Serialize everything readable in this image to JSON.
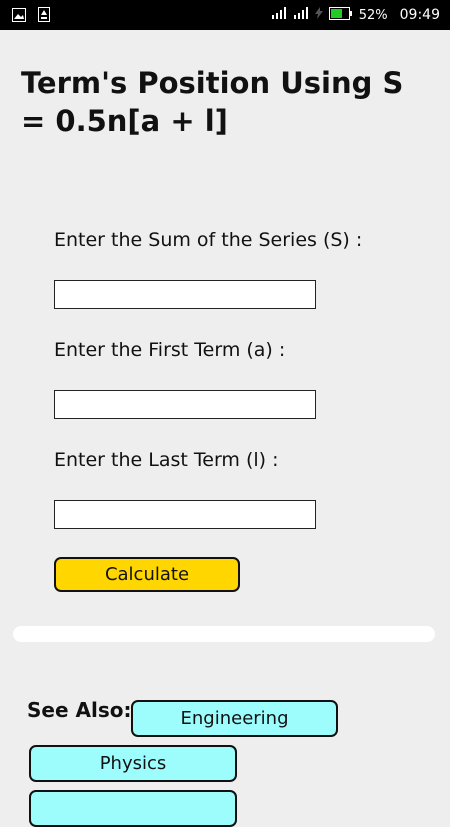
{
  "status_bar": {
    "battery_percent": "52%",
    "time": "09:49",
    "icons": [
      "gallery-icon",
      "upload-icon",
      "signal-icon",
      "signal-icon",
      "charging-icon",
      "battery-icon"
    ]
  },
  "page": {
    "title": "Term's Position Using S = 0.5n[a + l]"
  },
  "form": {
    "sum_label": "Enter the Sum of the Series (S) :",
    "sum_value": "",
    "first_label": "Enter the First Term (a) :",
    "first_value": "",
    "last_label": "Enter the Last Term (l) :",
    "last_value": "",
    "calculate_label": "Calculate"
  },
  "see_also": {
    "label": "See Also:",
    "links": [
      "Engineering",
      "Physics"
    ]
  },
  "colors": {
    "background": "#eeeeee",
    "button": "#ffd600",
    "chip": "#9dfdfd"
  }
}
